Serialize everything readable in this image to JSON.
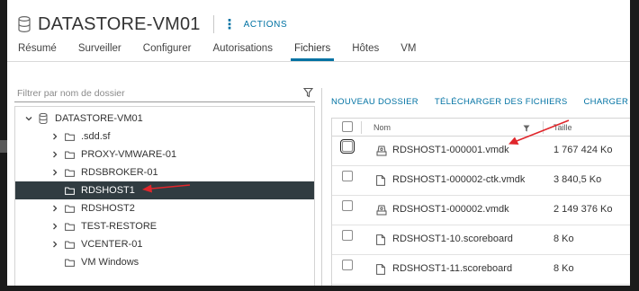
{
  "header": {
    "title": "DATASTORE-VM01",
    "actions_label": "ACTIONS",
    "icon": "datastore-icon"
  },
  "tabs": [
    {
      "label": "Résumé",
      "active": false
    },
    {
      "label": "Surveiller",
      "active": false
    },
    {
      "label": "Configurer",
      "active": false
    },
    {
      "label": "Autorisations",
      "active": false
    },
    {
      "label": "Fichiers",
      "active": true
    },
    {
      "label": "Hôtes",
      "active": false
    },
    {
      "label": "VM",
      "active": false
    }
  ],
  "filter": {
    "placeholder": "Filtrer par nom de dossier",
    "value": ""
  },
  "tree": {
    "root": "DATASTORE-VM01",
    "items": [
      {
        "label": ".sdd.sf",
        "expandable": true,
        "selected": false
      },
      {
        "label": "PROXY-VMWARE-01",
        "expandable": true,
        "selected": false
      },
      {
        "label": "RDSBROKER-01",
        "expandable": true,
        "selected": false
      },
      {
        "label": "RDSHOST1",
        "expandable": false,
        "selected": true
      },
      {
        "label": "RDSHOST2",
        "expandable": true,
        "selected": false
      },
      {
        "label": "TEST-RESTORE",
        "expandable": true,
        "selected": false
      },
      {
        "label": "VCENTER-01",
        "expandable": true,
        "selected": false
      },
      {
        "label": "VM Windows",
        "expandable": false,
        "selected": false
      }
    ]
  },
  "toolbar": {
    "new_folder": "NOUVEAU DOSSIER",
    "download": "TÉLÉCHARGER DES FICHIERS",
    "upload": "CHARGER UN DOSSIE"
  },
  "files": {
    "col_name": "Nom",
    "col_size": "Taille",
    "rows": [
      {
        "name": "RDSHOST1-000001.vmdk",
        "size": "1 767 424 Ko",
        "icon": "virtual-disk-icon"
      },
      {
        "name": "RDSHOST1-000002-ctk.vmdk",
        "size": "3 840,5 Ko",
        "icon": "file-icon"
      },
      {
        "name": "RDSHOST1-000002.vmdk",
        "size": "2 149 376 Ko",
        "icon": "virtual-disk-icon"
      },
      {
        "name": "RDSHOST1-10.scoreboard",
        "size": "8 Ko",
        "icon": "file-icon"
      },
      {
        "name": "RDSHOST1-11.scoreboard",
        "size": "8 Ko",
        "icon": "file-icon"
      }
    ]
  },
  "colors": {
    "accent": "#0072a3",
    "selected_row": "#313c41",
    "arrow": "#e0262b"
  }
}
